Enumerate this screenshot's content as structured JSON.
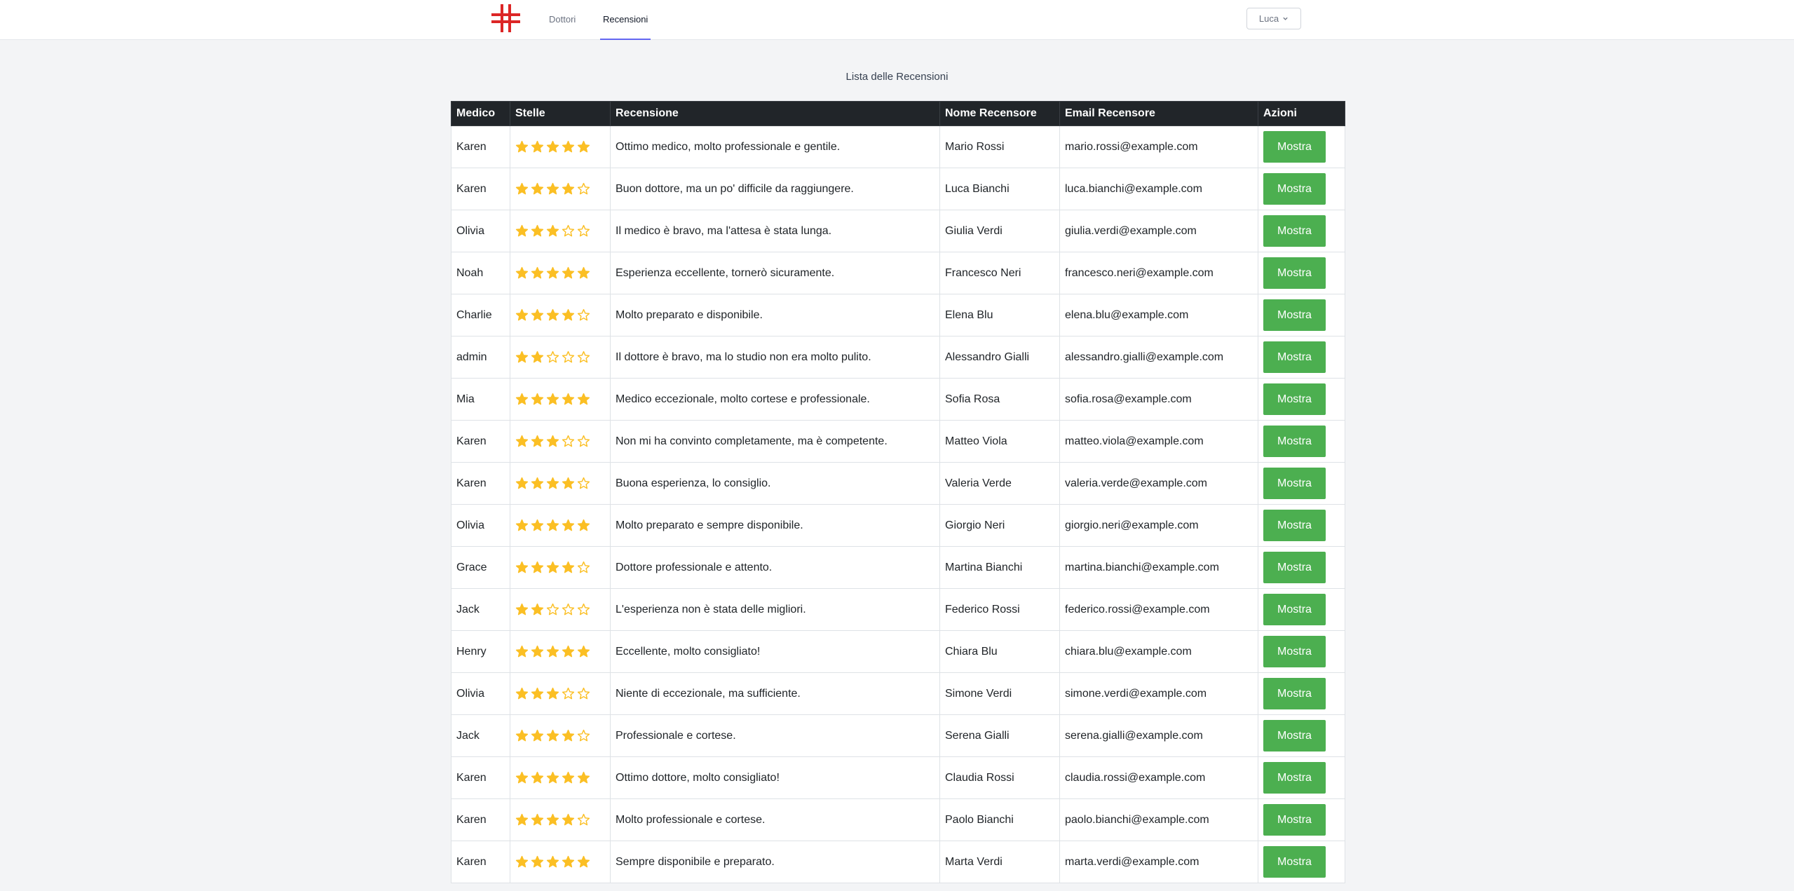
{
  "nav": {
    "links": [
      "Dottori",
      "Recensioni"
    ],
    "active": "Recensioni",
    "user": "Luca"
  },
  "page_title": "Lista delle Recensioni",
  "colors": {
    "accent": "#6366f1",
    "logo_red": "#dc2626",
    "star": "#fbbf24",
    "button": "#4caf50",
    "header_bg": "#212529"
  },
  "table": {
    "headers": [
      "Medico",
      "Stelle",
      "Recensione",
      "Nome Recensore",
      "Email Recensore",
      "Azioni"
    ],
    "action_label": "Mostra",
    "max_stars": 5,
    "rows": [
      {
        "medico": "Karen",
        "stelle": 5,
        "recensione": "Ottimo medico, molto professionale e gentile.",
        "nome": "Mario Rossi",
        "email": "mario.rossi@example.com"
      },
      {
        "medico": "Karen",
        "stelle": 4,
        "recensione": "Buon dottore, ma un po' difficile da raggiungere.",
        "nome": "Luca Bianchi",
        "email": "luca.bianchi@example.com"
      },
      {
        "medico": "Olivia",
        "stelle": 3,
        "recensione": "Il medico è bravo, ma l'attesa è stata lunga.",
        "nome": "Giulia Verdi",
        "email": "giulia.verdi@example.com"
      },
      {
        "medico": "Noah",
        "stelle": 5,
        "recensione": "Esperienza eccellente, tornerò sicuramente.",
        "nome": "Francesco Neri",
        "email": "francesco.neri@example.com"
      },
      {
        "medico": "Charlie",
        "stelle": 4,
        "recensione": "Molto preparato e disponibile.",
        "nome": "Elena Blu",
        "email": "elena.blu@example.com"
      },
      {
        "medico": "admin",
        "stelle": 2,
        "recensione": "Il dottore è bravo, ma lo studio non era molto pulito.",
        "nome": "Alessandro Gialli",
        "email": "alessandro.gialli@example.com"
      },
      {
        "medico": "Mia",
        "stelle": 5,
        "recensione": "Medico eccezionale, molto cortese e professionale.",
        "nome": "Sofia Rosa",
        "email": "sofia.rosa@example.com"
      },
      {
        "medico": "Karen",
        "stelle": 3,
        "recensione": "Non mi ha convinto completamente, ma è competente.",
        "nome": "Matteo Viola",
        "email": "matteo.viola@example.com"
      },
      {
        "medico": "Karen",
        "stelle": 4,
        "recensione": "Buona esperienza, lo consiglio.",
        "nome": "Valeria Verde",
        "email": "valeria.verde@example.com"
      },
      {
        "medico": "Olivia",
        "stelle": 5,
        "recensione": "Molto preparato e sempre disponibile.",
        "nome": "Giorgio Neri",
        "email": "giorgio.neri@example.com"
      },
      {
        "medico": "Grace",
        "stelle": 4,
        "recensione": "Dottore professionale e attento.",
        "nome": "Martina Bianchi",
        "email": "martina.bianchi@example.com"
      },
      {
        "medico": "Jack",
        "stelle": 2,
        "recensione": "L'esperienza non è stata delle migliori.",
        "nome": "Federico Rossi",
        "email": "federico.rossi@example.com"
      },
      {
        "medico": "Henry",
        "stelle": 5,
        "recensione": "Eccellente, molto consigliato!",
        "nome": "Chiara Blu",
        "email": "chiara.blu@example.com"
      },
      {
        "medico": "Olivia",
        "stelle": 3,
        "recensione": "Niente di eccezionale, ma sufficiente.",
        "nome": "Simone Verdi",
        "email": "simone.verdi@example.com"
      },
      {
        "medico": "Jack",
        "stelle": 4,
        "recensione": "Professionale e cortese.",
        "nome": "Serena Gialli",
        "email": "serena.gialli@example.com"
      },
      {
        "medico": "Karen",
        "stelle": 5,
        "recensione": "Ottimo dottore, molto consigliato!",
        "nome": "Claudia Rossi",
        "email": "claudia.rossi@example.com"
      },
      {
        "medico": "Karen",
        "stelle": 4,
        "recensione": "Molto professionale e cortese.",
        "nome": "Paolo Bianchi",
        "email": "paolo.bianchi@example.com"
      },
      {
        "medico": "Karen",
        "stelle": 5,
        "recensione": "Sempre disponibile e preparato.",
        "nome": "Marta Verdi",
        "email": "marta.verdi@example.com"
      }
    ]
  }
}
